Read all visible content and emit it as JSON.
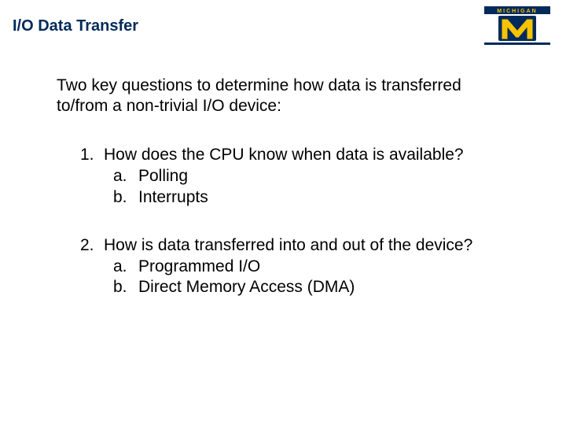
{
  "title": "I/O Data Transfer",
  "logo": {
    "top_text": "MICHIGAN",
    "colors": {
      "blue": "#002a5b",
      "maize": "#f8c300"
    }
  },
  "intro": "Two key questions to determine how data is transferred to/from a non-trivial I/O device:",
  "questions": [
    {
      "num": "1.",
      "text": "How does the CPU know when data is available?",
      "subs": [
        {
          "letter": "a.",
          "text": "Polling"
        },
        {
          "letter": "b.",
          "text": "Interrupts"
        }
      ]
    },
    {
      "num": "2.",
      "text": "How is data  transferred into and out of the device?",
      "subs": [
        {
          "letter": "a.",
          "text": "Programmed I/O"
        },
        {
          "letter": "b.",
          "text": "Direct Memory Access (DMA)"
        }
      ]
    }
  ]
}
